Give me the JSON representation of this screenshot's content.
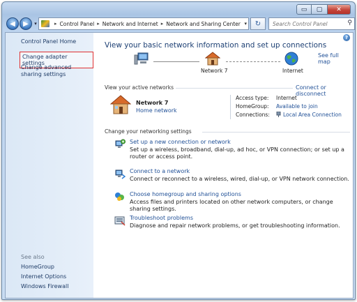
{
  "window": {
    "caption": {
      "minimize": "▭",
      "maximize": "▢",
      "close": "✕"
    }
  },
  "address_bar": {
    "back_glyph": "◀",
    "forward_glyph": "▶",
    "dropdown_glyph": "▾",
    "crumbs": [
      "Control Panel",
      "Network and Internet",
      "Network and Sharing Center"
    ],
    "separator": "▸",
    "refresh_glyph": "↻",
    "search_placeholder": "Search Control Panel",
    "search_glyph": "⚲"
  },
  "sidebar": {
    "home": "Control Panel Home",
    "tasks": [
      "Change adapter settings",
      "Change advanced sharing settings"
    ],
    "see_also_label": "See also",
    "see_also": [
      "HomeGroup",
      "Internet Options",
      "Windows Firewall"
    ]
  },
  "main": {
    "help_glyph": "?",
    "title": "View your basic network information and set up connections",
    "see_full_map": "See full map",
    "map": {
      "network_label": "Network 7",
      "internet_label": "Internet"
    },
    "active_networks_heading": "View your active networks",
    "connect_or_disconnect": "Connect or disconnect",
    "network": {
      "name": "Network 7",
      "type": "Home network",
      "access_type_label": "Access type:",
      "access_type_value": "Internet",
      "homegroup_label": "HomeGroup:",
      "homegroup_value": "Available to join",
      "connections_label": "Connections:",
      "connections_value": "Local Area Connection"
    },
    "settings_heading": "Change your networking settings",
    "tasks": [
      {
        "title": "Set up a new connection or network",
        "description": "Set up a wireless, broadband, dial-up, ad hoc, or VPN connection; or set up a router or access point.",
        "icon": "new-connection-icon"
      },
      {
        "title": "Connect to a network",
        "description": "Connect or reconnect to a wireless, wired, dial-up, or VPN network connection.",
        "icon": "connect-network-icon"
      },
      {
        "title": "Choose homegroup and sharing options",
        "description": "Access files and printers located on other network computers, or change sharing settings.",
        "icon": "homegroup-icon"
      },
      {
        "title": "Troubleshoot problems",
        "description": "Diagnose and repair network problems, or get troubleshooting information.",
        "icon": "troubleshoot-icon"
      }
    ]
  }
}
